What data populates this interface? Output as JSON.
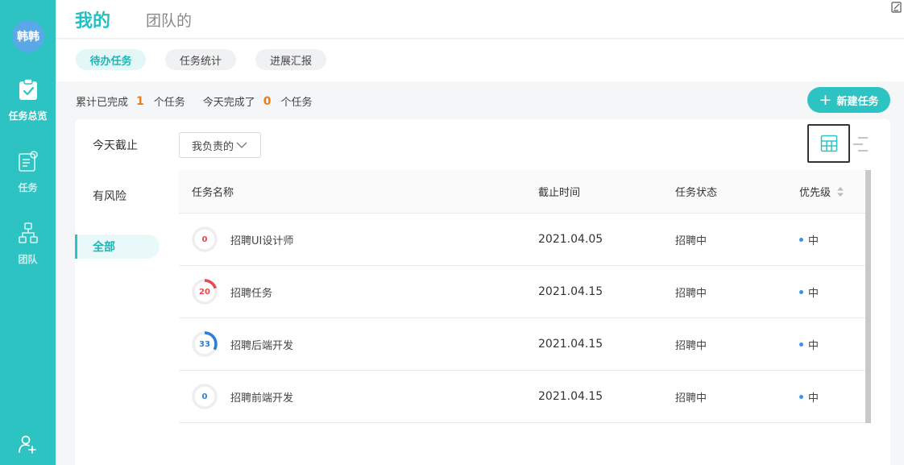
{
  "user": {
    "avatar_text": "韩韩"
  },
  "sidebar": {
    "items": [
      {
        "label": "任务总览",
        "icon": "clipboard-check-icon",
        "active": true
      },
      {
        "label": "任务",
        "icon": "task-list-icon",
        "active": false
      },
      {
        "label": "团队",
        "icon": "org-tree-icon",
        "active": false
      }
    ],
    "bottom_icon": "add-user-icon"
  },
  "header": {
    "tabs": [
      {
        "label": "我的",
        "active": true
      },
      {
        "label": "团队的",
        "active": false
      }
    ]
  },
  "subtabs": [
    {
      "label": "待办任务",
      "active": true
    },
    {
      "label": "任务统计",
      "active": false
    },
    {
      "label": "进展汇报",
      "active": false
    }
  ],
  "summary": {
    "total_prefix": "累计已完成",
    "total_count": "1",
    "total_suffix": "个任务",
    "today_prefix": "今天完成了",
    "today_count": "0",
    "today_suffix": "个任务"
  },
  "new_task_label": "新建任务",
  "filters": [
    {
      "label": "今天截止",
      "active": false
    },
    {
      "label": "有风险",
      "active": false
    },
    {
      "label": "全部",
      "active": true
    }
  ],
  "dropdown": {
    "selected": "我负责的"
  },
  "table": {
    "columns": [
      "任务名称",
      "截止时间",
      "任务状态",
      "优先级"
    ],
    "rows": [
      {
        "progress": 0,
        "progress_label": "0",
        "color": "#e8474e",
        "name": "招聘UI设计师",
        "due": "2021.04.05",
        "status": "招聘中",
        "priority": "中"
      },
      {
        "progress": 20,
        "progress_label": "20",
        "color": "#e8474e",
        "name": "招聘任务",
        "due": "2021.04.15",
        "status": "招聘中",
        "priority": "中"
      },
      {
        "progress": 33,
        "progress_label": "33",
        "color": "#2b7fd8",
        "name": "招聘后端开发",
        "due": "2021.04.15",
        "status": "招聘中",
        "priority": "中"
      },
      {
        "progress": 0,
        "progress_label": "0",
        "color": "#2b7fd8",
        "name": "招聘前端开发",
        "due": "2021.04.15",
        "status": "招聘中",
        "priority": "中"
      }
    ]
  },
  "colors": {
    "accent": "#2ec3c3",
    "highlight_number": "#f17b0f",
    "priority_dot": "#3f8ef0"
  }
}
